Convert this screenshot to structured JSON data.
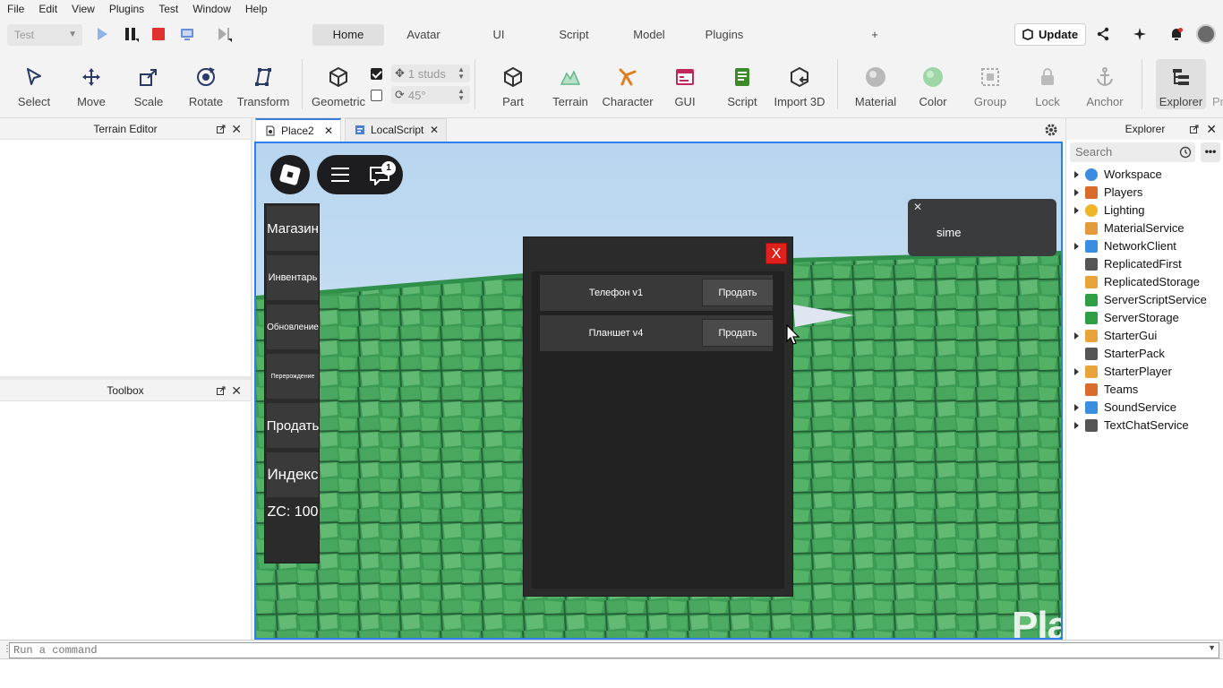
{
  "menu": [
    "File",
    "Edit",
    "View",
    "Plugins",
    "Test",
    "Window",
    "Help"
  ],
  "test_mode": {
    "value": "Test"
  },
  "ribbon_tabs": [
    "Home",
    "Avatar",
    "UI",
    "Script",
    "Model",
    "Plugins",
    "+"
  ],
  "active_tab": "Home",
  "update_label": "Update",
  "tools": {
    "select": "Select",
    "move": "Move",
    "scale": "Scale",
    "rotate": "Rotate",
    "transform": "Transform",
    "geometric": "Geometric",
    "part": "Part",
    "terrain": "Terrain",
    "character": "Character",
    "gui": "GUI",
    "script": "Script",
    "import3d": "Import 3D",
    "material": "Material",
    "color": "Color",
    "group": "Group",
    "lock": "Lock",
    "anchor": "Anchor",
    "explorer": "Explorer",
    "properties_partial": "Pr"
  },
  "snapping": {
    "move": "1 studs",
    "rotate": "45°",
    "move_checked": true,
    "rotate_checked": false
  },
  "panels": {
    "terrain_editor": "Terrain Editor",
    "toolbox": "Toolbox",
    "explorer": "Explorer"
  },
  "doc_tabs": [
    {
      "label": "Place2",
      "active": true
    },
    {
      "label": "LocalScript",
      "active": false
    }
  ],
  "game": {
    "chat_badge": "1",
    "side_buttons": [
      {
        "label": "Магазин",
        "size": 15
      },
      {
        "label": "Инвентарь",
        "size": 11
      },
      {
        "label": "Обновление",
        "size": 10
      },
      {
        "label": "Перерождение",
        "size": 7
      },
      {
        "label": "Продать",
        "size": 15
      },
      {
        "label": "Индекс",
        "size": 17
      }
    ],
    "zc": "ZC: 100",
    "shop_close": "X",
    "shop_items": [
      {
        "name": "Телефон v1",
        "action": "Продать"
      },
      {
        "name": "Планшет v4",
        "action": "Продать"
      }
    ],
    "notification": "sime",
    "watermark": "Playerok"
  },
  "explorer": {
    "search_placeholder": "Search",
    "items": [
      {
        "name": "Workspace",
        "expandable": true,
        "icon": "globe-icon",
        "color": "#3b8de0"
      },
      {
        "name": "Players",
        "expandable": true,
        "icon": "players-icon",
        "color": "#d96b2b"
      },
      {
        "name": "Lighting",
        "expandable": true,
        "icon": "lightbulb-icon",
        "color": "#f0b429"
      },
      {
        "name": "MaterialService",
        "expandable": false,
        "icon": "material-icon",
        "color": "#e39a3a"
      },
      {
        "name": "NetworkClient",
        "expandable": true,
        "icon": "network-icon",
        "color": "#3b8de0"
      },
      {
        "name": "ReplicatedFirst",
        "expandable": false,
        "icon": "replicated-first-icon",
        "color": "#555555"
      },
      {
        "name": "ReplicatedStorage",
        "expandable": false,
        "icon": "replicated-storage-icon",
        "color": "#e8a33a"
      },
      {
        "name": "ServerScriptService",
        "expandable": false,
        "icon": "server-script-icon",
        "color": "#2f9e44"
      },
      {
        "name": "ServerStorage",
        "expandable": false,
        "icon": "server-storage-icon",
        "color": "#2f9e44"
      },
      {
        "name": "StarterGui",
        "expandable": true,
        "icon": "starter-gui-icon",
        "color": "#e8a33a"
      },
      {
        "name": "StarterPack",
        "expandable": false,
        "icon": "starter-pack-icon",
        "color": "#555555"
      },
      {
        "name": "StarterPlayer",
        "expandable": true,
        "icon": "starter-player-icon",
        "color": "#e8a33a"
      },
      {
        "name": "Teams",
        "expandable": false,
        "icon": "teams-icon",
        "color": "#d96b2b"
      },
      {
        "name": "SoundService",
        "expandable": true,
        "icon": "sound-icon",
        "color": "#3b8de0"
      },
      {
        "name": "TextChatService",
        "expandable": true,
        "icon": "text-chat-icon",
        "color": "#555555"
      }
    ]
  },
  "command_bar": {
    "placeholder": "Run a command"
  },
  "colors": {
    "accent": "#2d7ff0",
    "close_red": "#e0201a",
    "ui_dark": "#2b2b2b",
    "grass": "#3fa056"
  }
}
